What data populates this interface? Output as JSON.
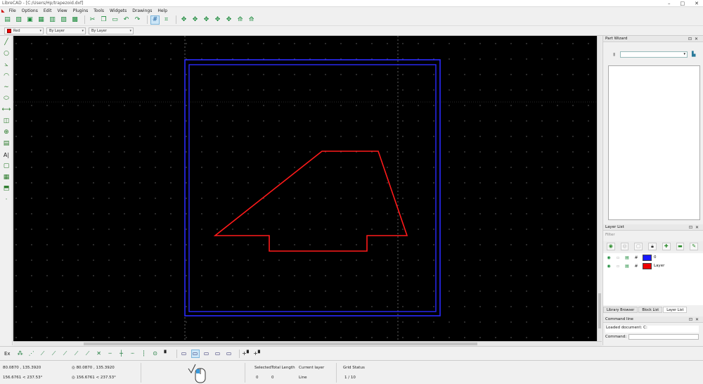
{
  "window": {
    "title": "LibreCAD - [C:/Users/Hp/trapezoid.dxf]",
    "controls": [
      "–",
      "□",
      "✕"
    ]
  },
  "menu": [
    "File",
    "Options",
    "Edit",
    "View",
    "Plugins",
    "Tools",
    "Widgets",
    "Drawings",
    "Help"
  ],
  "pen_toolbar": {
    "color": "Red",
    "color_hex": "#ee0000",
    "line_type": "By Layer",
    "line_width": "By Layer"
  },
  "panels": {
    "part_wizard": {
      "title": "Part Wizard"
    },
    "layer_list": {
      "title": "Layer List",
      "filter_placeholder": "Filter",
      "layers": [
        {
          "name": "0",
          "color": "#1a1aff"
        },
        {
          "name": "Layer",
          "color": "#ee0000"
        }
      ],
      "tabs": [
        "Library Browser",
        "Block List",
        "Layer List"
      ]
    },
    "command_line": {
      "title": "Command line",
      "output": "Loaded document: C:",
      "prompt": "Command:"
    }
  },
  "snap_toolbar": {
    "label": "Ex"
  },
  "status": {
    "coords": {
      "abs_cart": "80.0870 , 135.3920",
      "abs_polar": "156.6761 < 237.53°",
      "rel_cart": "80.0870 , 135.3920",
      "rel_polar": "156.6761 < 237.53°"
    },
    "selected": {
      "label": "Selected",
      "value": "0"
    },
    "total_length": {
      "label": "Total Length",
      "value": "0"
    },
    "current_layer": {
      "label": "Current layer",
      "value": "Line"
    },
    "grid_status": {
      "label": "Grid Status",
      "value": "1 / 10"
    }
  },
  "drawing": {
    "border_color": "#2a2aff",
    "shape_color": "#ff1a1a",
    "background": "#000000"
  }
}
